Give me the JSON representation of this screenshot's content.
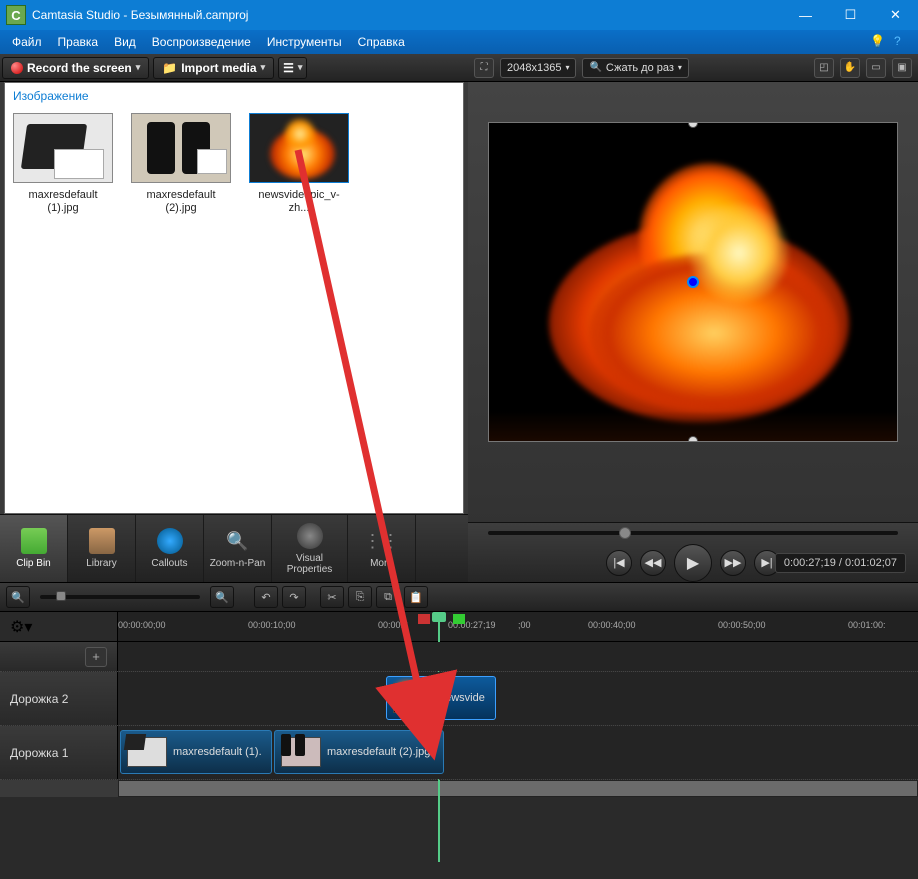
{
  "window": {
    "title": "Camtasia Studio - Безымянный.camproj"
  },
  "menu": {
    "items": [
      "Файл",
      "Правка",
      "Вид",
      "Воспроизведение",
      "Инструменты",
      "Справка"
    ]
  },
  "toolbar": {
    "record": "Record the screen",
    "import": "Import media"
  },
  "clipbin": {
    "header": "Изображение",
    "items": [
      {
        "name": "maxresdefault (1).jpg"
      },
      {
        "name": "maxresdefault (2).jpg"
      },
      {
        "name": "newsvideopic_v-zh..."
      }
    ]
  },
  "tabs": {
    "items": [
      "Clip Bin",
      "Library",
      "Callouts",
      "Zoom-n-Pan",
      "Visual Properties",
      "More"
    ]
  },
  "preview": {
    "dimensions": "2048x1365",
    "shrink": "Сжать до раз",
    "timecode": "0:00:27;19 / 0:01:02;07"
  },
  "ruler": {
    "gear": "⚙",
    "ticks": [
      "00:00:00;00",
      "00:00:10;00",
      "00:00:2",
      "00:00:27;19",
      ";00",
      "00:00:40;00",
      "00:00:50;00",
      "00:01:00:"
    ]
  },
  "tracks": {
    "track2": {
      "label": "Дорожка 2",
      "clip": "newsvide"
    },
    "track1": {
      "label": "Дорожка 1",
      "clips": [
        "maxresdefault (1).",
        "maxresdefault (2).jpg"
      ]
    }
  }
}
